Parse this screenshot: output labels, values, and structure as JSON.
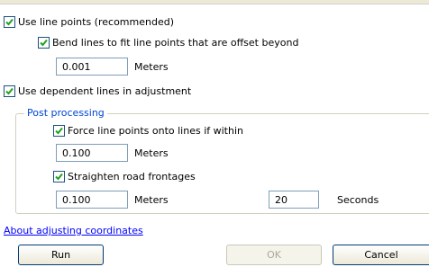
{
  "options": {
    "use_line_points": {
      "label": "Use line points (recommended)",
      "checked": true
    },
    "bend_lines": {
      "label": "Bend lines to fit line points that are offset beyond",
      "checked": true
    },
    "bend_value": "0.001",
    "bend_unit": "Meters",
    "use_dependent_lines": {
      "label": "Use dependent lines in adjustment",
      "checked": true
    }
  },
  "post_processing": {
    "title": "Post processing",
    "force_line_points": {
      "label": "Force line points onto lines if within",
      "checked": true
    },
    "force_value": "0.100",
    "force_unit": "Meters",
    "straighten": {
      "label": "Straighten road frontages",
      "checked": true
    },
    "straighten_value": "0.100",
    "straighten_unit": "Meters",
    "seconds_value": "20",
    "seconds_unit": "Seconds"
  },
  "footer": {
    "link": "About adjusting coordinates",
    "run": "Run",
    "ok": "OK",
    "cancel": "Cancel"
  },
  "colors": {
    "check": "#21a121",
    "link": "#0000ff",
    "group_title": "#0046d5"
  }
}
